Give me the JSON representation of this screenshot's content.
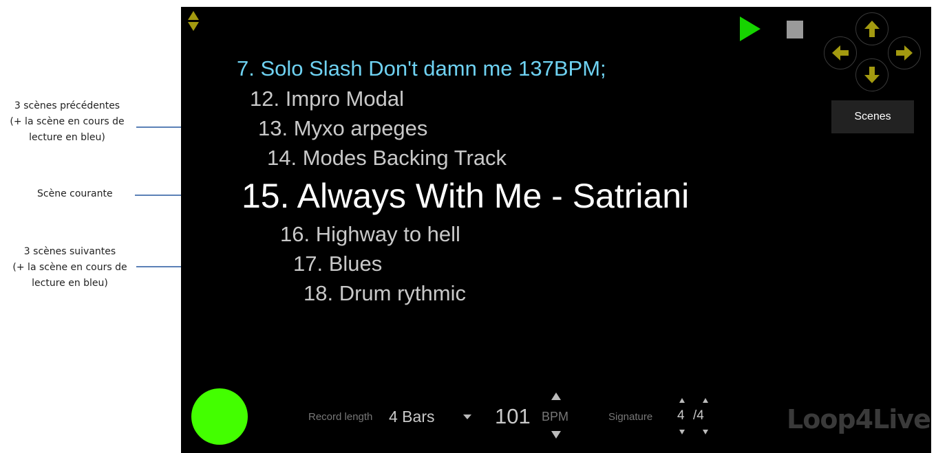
{
  "annotations": {
    "previous": [
      "3 scènes précédentes",
      "(+ la scène en cours de",
      "lecture en bleu)"
    ],
    "current": "Scène courante",
    "next": [
      "3 scènes suivantes",
      "(+ la scène en cours de",
      "lecture en bleu)"
    ]
  },
  "scenes": {
    "playing": "7. Solo Slash Don't damn me 137BPM;",
    "previous": [
      "12. Impro Modal",
      "13. Myxo arpeges",
      "14. Modes Backing Track"
    ],
    "current": "15. Always With Me - Satriani",
    "next": [
      "16. Highway to hell",
      "17. Blues",
      "18. Drum rythmic"
    ]
  },
  "buttons": {
    "scenes_label": "Scenes"
  },
  "bottom_bar": {
    "record_length_label": "Record length",
    "record_length_value": "4 Bars",
    "tempo_value": "101",
    "tempo_unit": "BPM",
    "signature_label": "Signature",
    "signature_numerator": "4",
    "signature_denominator": "/4"
  },
  "logo_text": "Loop4Live",
  "colors": {
    "playing_scene": "#6fd2f2",
    "play_button": "#16d400",
    "record_indicator": "#43ff00",
    "nav_arrows": "#a39a10"
  },
  "icons": [
    "scroll-arrows-icon",
    "play-icon",
    "stop-icon",
    "arrow-up-icon",
    "arrow-left-icon",
    "arrow-right-icon",
    "arrow-down-icon",
    "dropdown-icon"
  ]
}
